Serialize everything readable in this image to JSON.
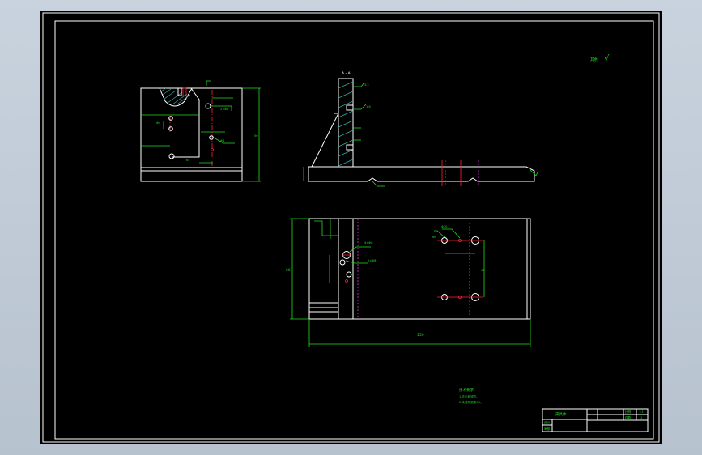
{
  "colors": {
    "background": "#000000",
    "outline": "#ffffff",
    "dimension": "#22dd22",
    "centerline": "#ff2030",
    "hidden": "#dd33dd",
    "hatch": "#33aaaa"
  },
  "labels": {
    "section_label": "A - A",
    "roughness_note": "其余",
    "roughness_symbol": "√",
    "front_dim_width": "65",
    "front_dim_height": "50",
    "front_hole_1": "2×Φ8",
    "front_hole_2": "Φ6",
    "plan_dim_width": "150",
    "plan_dim_height": "66",
    "plan_hole_1": "4×Φ8",
    "plan_hole_2": "2×Φ8",
    "plan_hole_3": "Φ10",
    "plan_dim_small": "Φ4",
    "plan_dim_spacing": "40",
    "side_dim_1": "3.2",
    "side_dim_2": "1.6",
    "tech_title": "技术要求",
    "tech_line_1": "1.去毛刺锐边。",
    "tech_line_2": "2.未注明倒角C1。",
    "title_name": "夹具体",
    "title_cell_1": "设计",
    "title_cell_2": "审核",
    "title_cell_3": "比例",
    "title_cell_4": "1:1",
    "title_cell_5": "件数",
    "title_cell_6": "1"
  }
}
